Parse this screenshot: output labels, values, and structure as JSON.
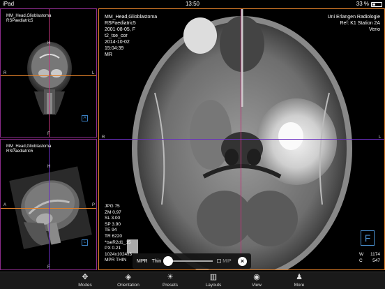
{
  "status_bar": {
    "device": "iPad",
    "time": "13:50",
    "battery": "33 %"
  },
  "viewports": {
    "coronal": {
      "patient": "MM_Head,Glioblastoma",
      "series": "RSPaediatric5",
      "orient_top": "H",
      "orient_left": "R",
      "orient_right": "L",
      "orient_bottom": "F",
      "label": "A"
    },
    "sagittal": {
      "patient": "MM_Head,Glioblastoma",
      "series": "RSPaediatric5",
      "orient_top": "H",
      "orient_left": "A",
      "orient_right": "P",
      "orient_bottom": "F",
      "label": "L"
    },
    "axial": {
      "patient": "MM_Head,Glioblastoma",
      "series": "RSPaediatric5",
      "birth": "2001-08-05, F",
      "protocol": "t2_tse_cor",
      "date": "2014-10-02",
      "time": "15:04:39",
      "modality": "MR",
      "institution": "Uni Erlangen Radiologie",
      "ref": "Ref: K1 Station 2A",
      "device": "Verio",
      "orient_top": "A",
      "orient_left": "R",
      "orient_right": "L",
      "orient_bottom": "P",
      "label": "F",
      "params": [
        "JPG 75",
        "ZM 0.97",
        "SL 3.00",
        "SP 3.90",
        "TE 94",
        "TR 6220",
        "*tseR2d1_15",
        "PX 0.21",
        "1024x1024x3",
        "MPR THIN"
      ],
      "window": {
        "w_label": "W",
        "w_value": "1174",
        "c_label": "C",
        "c_value": "547"
      }
    }
  },
  "mpr_panel": {
    "mode": "MPR",
    "thickness": "Thin",
    "mip": "MIP",
    "close": "×",
    "slider_fraction": 0
  },
  "toolbar": {
    "items": [
      {
        "label": "Modes",
        "icon": "modes-icon"
      },
      {
        "label": "Orientation",
        "icon": "orientation-icon"
      },
      {
        "label": "Presets",
        "icon": "presets-icon"
      },
      {
        "label": "Layouts",
        "icon": "layouts-icon"
      },
      {
        "label": "View",
        "icon": "view-icon"
      },
      {
        "label": "More",
        "icon": "more-icon"
      }
    ]
  },
  "colors": {
    "coronal_border": "#8a2b8a",
    "axial_border": "#e0802a",
    "crosshair_h": "#6a2fc0",
    "crosshair_v": "#c0357a",
    "accent_blue": "#4a90d0"
  }
}
